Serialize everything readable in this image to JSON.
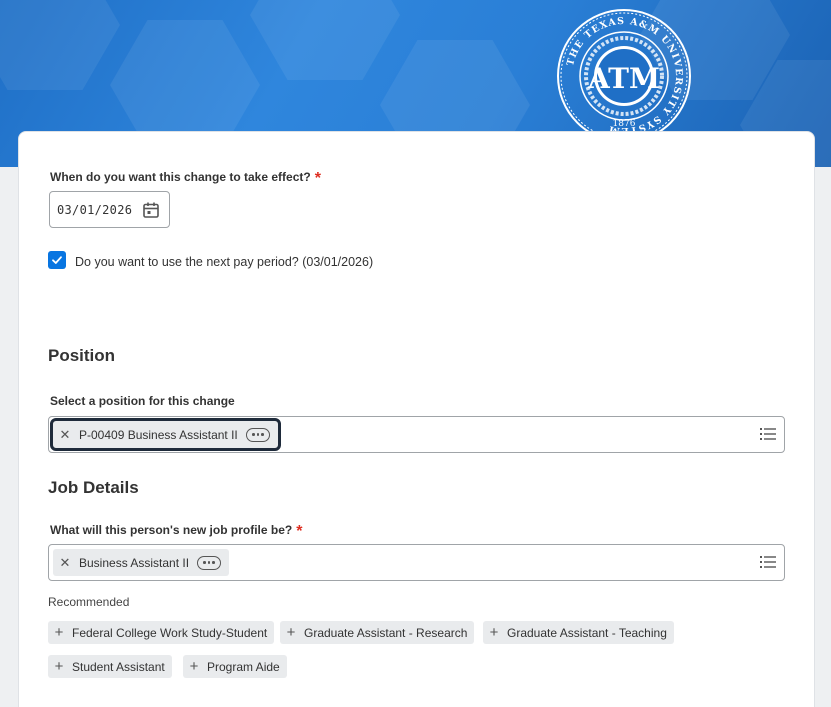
{
  "seal": {
    "ring_text": "THE TEXAS A&M UNIVERSITY SYSTEM",
    "monogram": "ATM",
    "year": "1876"
  },
  "effective_date": {
    "label": "When do you want this change to take effect?",
    "required_mark": "*",
    "value": "03/01/2026",
    "icon": "calendar-icon"
  },
  "next_pay_period": {
    "checked": true,
    "label": "Do you want to use the next pay period? (03/01/2026)"
  },
  "position": {
    "section_title": "Position",
    "field_label": "Select a position for this change",
    "selected": "P-00409 Business Assistant II"
  },
  "job_details": {
    "section_title": "Job Details",
    "field_label": "What will this person's new job profile be?",
    "required_mark": "*",
    "selected": "Business Assistant II",
    "recommended_label": "Recommended",
    "recommended": [
      "Federal College Work Study-Student",
      "Graduate Assistant - Research",
      "Graduate Assistant - Teaching",
      "Student Assistant",
      "Program Aide"
    ]
  },
  "colors": {
    "accent": "#0875e1",
    "required": "#de2e21",
    "banner": "#2a7fd6",
    "focus": "#1e2a3a"
  }
}
